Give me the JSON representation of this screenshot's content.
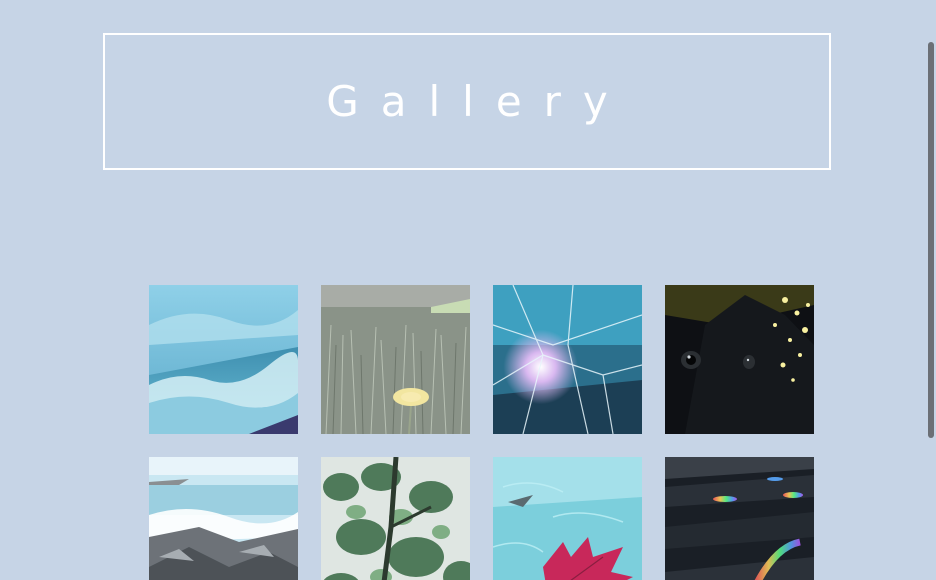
{
  "header": {
    "title": "Gallery"
  },
  "gallery": {
    "photos": [
      {
        "subject": "ocean-waves-photo"
      },
      {
        "subject": "dandelion-grass-photo"
      },
      {
        "subject": "cracked-ice-photo"
      },
      {
        "subject": "black-cat-lights-photo"
      },
      {
        "subject": "rocky-shore-photo"
      },
      {
        "subject": "green-leaves-photo"
      },
      {
        "subject": "red-leaf-water-photo"
      },
      {
        "subject": "wet-bench-rainbow-photo"
      }
    ]
  }
}
